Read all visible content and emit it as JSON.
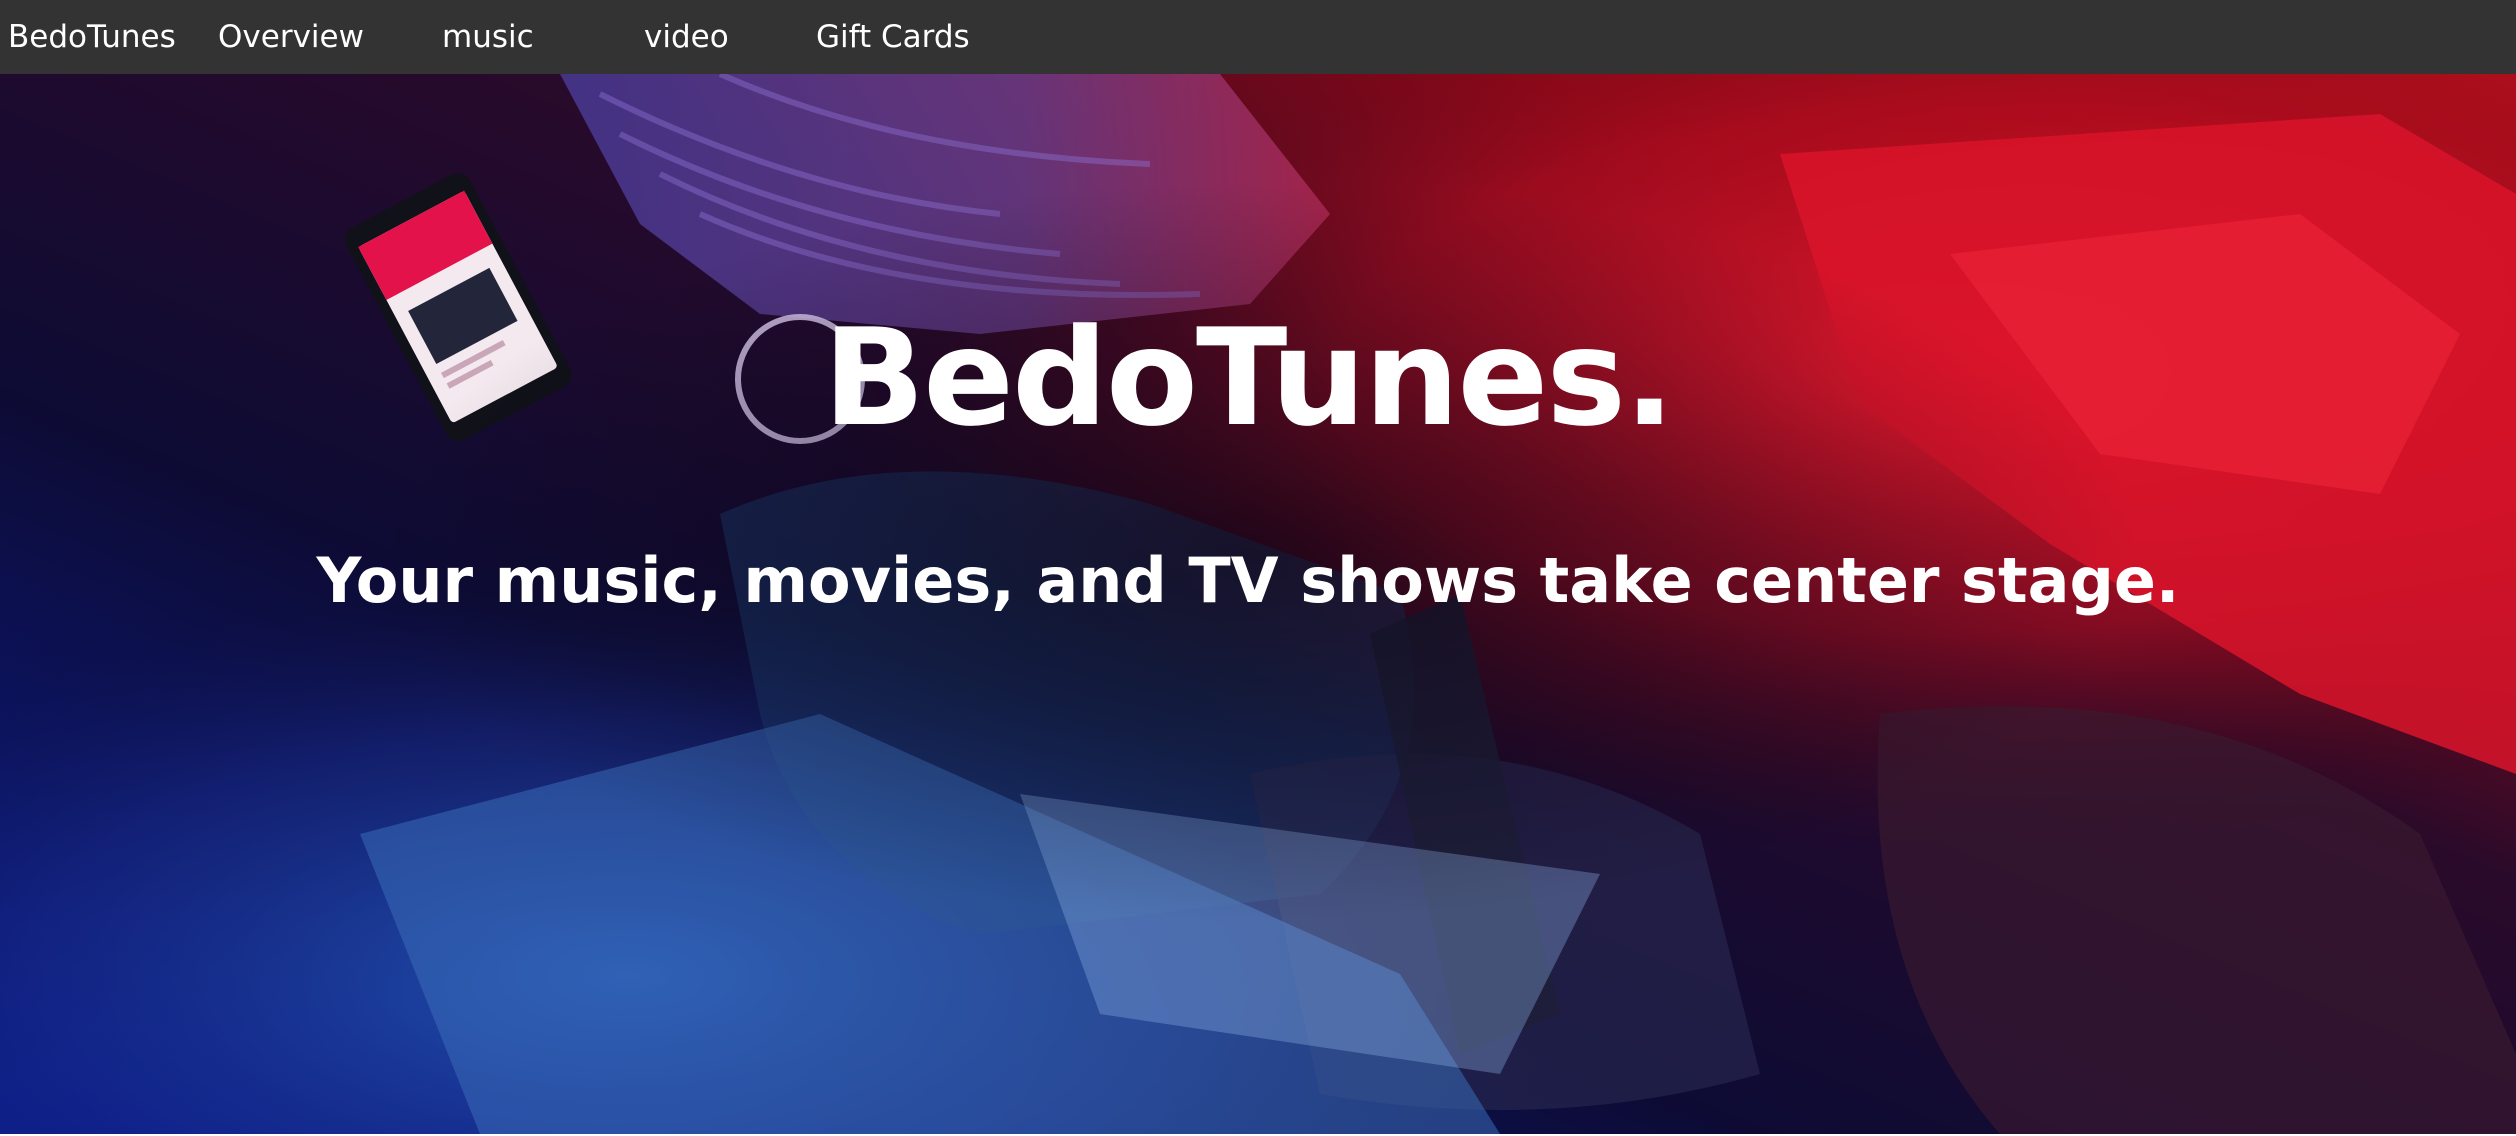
{
  "nav": {
    "brand": "BedoTunes",
    "items": [
      {
        "label": "Overview"
      },
      {
        "label": "music"
      },
      {
        "label": "video"
      },
      {
        "label": "Gift Cards"
      }
    ],
    "background": "#333333"
  },
  "hero": {
    "title": "BedoTunes.",
    "subtitle": "Your music, movies, and TV shows take center stage.",
    "text_color": "#ffffff",
    "gradient_colors": [
      "#0a1a8c",
      "#3a0f5c",
      "#e0102a"
    ]
  }
}
